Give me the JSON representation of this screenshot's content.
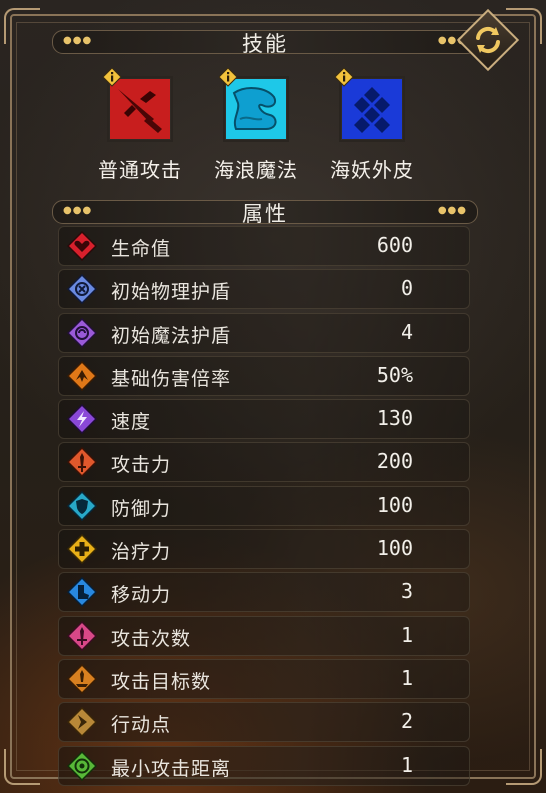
{
  "skills_section": {
    "title": "技能"
  },
  "skills": [
    {
      "name": "普通攻击",
      "color": "#c81e1e",
      "icon": "spear-attack-icon"
    },
    {
      "name": "海浪魔法",
      "color": "#1ec8e8",
      "icon": "wave-magic-icon"
    },
    {
      "name": "海妖外皮",
      "color": "#1a3ad8",
      "icon": "scale-skin-icon"
    }
  ],
  "attributes_section": {
    "title": "属性"
  },
  "attributes": [
    {
      "label": "生命值",
      "value": "600",
      "icon": "heart-icon",
      "color": "#d8202c"
    },
    {
      "label": "初始物理护盾",
      "value": "0",
      "icon": "physical-shield-icon",
      "color": "#6a8ae0"
    },
    {
      "label": "初始魔法护盾",
      "value": "4",
      "icon": "magic-shield-icon",
      "color": "#9a5ad8"
    },
    {
      "label": "基础伤害倍率",
      "value": "50%",
      "icon": "damage-rate-icon",
      "color": "#e07818"
    },
    {
      "label": "速度",
      "value": "130",
      "icon": "speed-icon",
      "color": "#8a48d8"
    },
    {
      "label": "攻击力",
      "value": "200",
      "icon": "attack-icon",
      "color": "#e0582c"
    },
    {
      "label": "防御力",
      "value": "100",
      "icon": "defense-icon",
      "color": "#28a8c8"
    },
    {
      "label": "治疗力",
      "value": "100",
      "icon": "heal-icon",
      "color": "#e8b018"
    },
    {
      "label": "移动力",
      "value": "3",
      "icon": "move-icon",
      "color": "#2888e0"
    },
    {
      "label": "攻击次数",
      "value": "1",
      "icon": "attack-count-icon",
      "color": "#d84888"
    },
    {
      "label": "攻击目标数",
      "value": "1",
      "icon": "attack-targets-icon",
      "color": "#d88020"
    },
    {
      "label": "行动点",
      "value": "2",
      "icon": "action-point-icon",
      "color": "#b88838"
    },
    {
      "label": "最小攻击距离",
      "value": "1",
      "icon": "min-range-icon",
      "color": "#58b838"
    }
  ]
}
